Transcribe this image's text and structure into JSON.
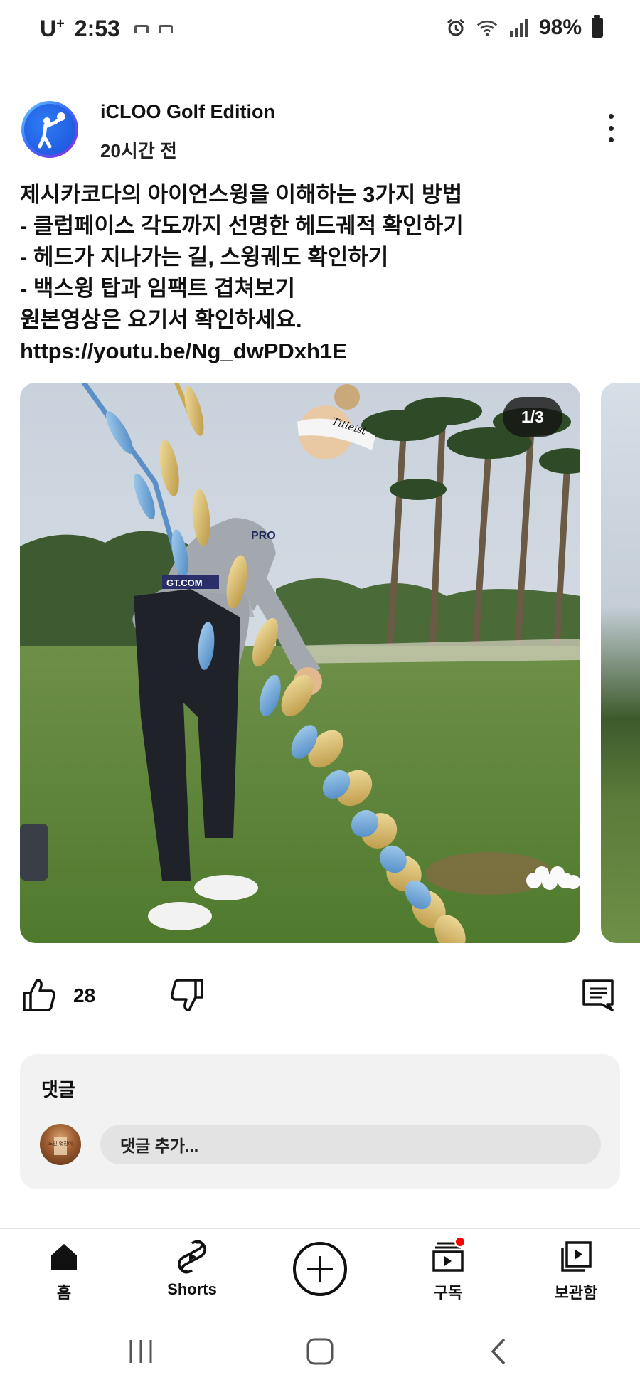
{
  "status_bar": {
    "carrier": "U",
    "carrier_sup": "+",
    "time": "2:53",
    "battery": "98%",
    "icons": [
      "alarm-icon",
      "wifi-icon",
      "signal-icon",
      "battery-icon"
    ]
  },
  "post": {
    "channel_name": "iCLOO Golf Edition",
    "time_ago": "20시간 전",
    "text_lines": [
      "제시카코다의 아이언스윙을 이해하는 3가지 방법",
      "- 클럽페이스 각도까지 선명한 헤드궤적 확인하기",
      "- 헤드가 지나가는 길, 스윙궤도 확인하기",
      "- 백스윙 탑과 임팩트 겹쳐보기",
      "원본영상은 요기서 확인하세요.",
      "https://youtu.be/Ng_dwPDxh1E"
    ],
    "image_counter": "1/3",
    "image_texts": {
      "visor_brand": "Titleist",
      "shirt_logo": "PRO",
      "belt_text": "GT.COM"
    }
  },
  "actions": {
    "like_count": "28"
  },
  "comments": {
    "title": "댓글",
    "placeholder": "댓글 추가...",
    "avatar_text": "노인 멋장이"
  },
  "bottom_nav": {
    "home": "홈",
    "shorts": "Shorts",
    "subscriptions": "구독",
    "library": "보관함"
  },
  "colors": {
    "accent_red": "#ff0000",
    "text": "#0f0f0f",
    "card_bg": "#f2f2f2"
  }
}
